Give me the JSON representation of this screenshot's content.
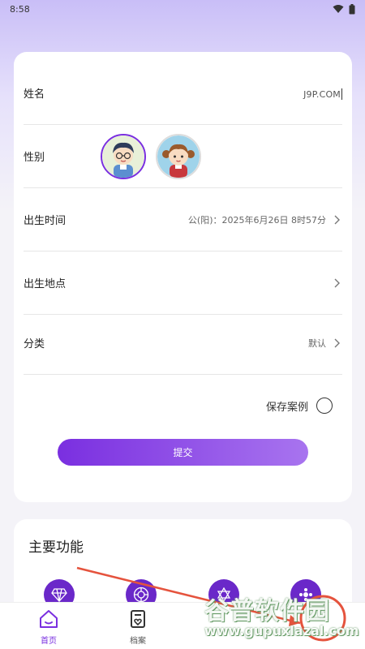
{
  "status_bar": {
    "time": "8:58"
  },
  "form": {
    "name_label": "姓名",
    "name_value": "J9P.COM",
    "gender_label": "性别",
    "birth_time_label": "出生时间",
    "birth_time_value": "公(阳)：2025年6月26日 8时57分",
    "birth_place_label": "出生地点",
    "birth_place_value": "",
    "category_label": "分类",
    "category_value": "默认",
    "save_case_label": "保存案例",
    "save_case_checked": false,
    "submit_label": "提交"
  },
  "features": {
    "title": "主要功能"
  },
  "tabbar": {
    "items": [
      {
        "label": "首页",
        "icon": "home-icon",
        "active": true
      },
      {
        "label": "档案",
        "icon": "archive-icon",
        "active": false
      }
    ]
  },
  "watermark": {
    "main": "谷普软件园",
    "url": "www.gupuxlazal.com"
  },
  "colors": {
    "accent": "#7a2fe0",
    "accent_light": "#a874ef",
    "feature_icon": "#6a28c9",
    "annotation_red": "#e5533d"
  }
}
